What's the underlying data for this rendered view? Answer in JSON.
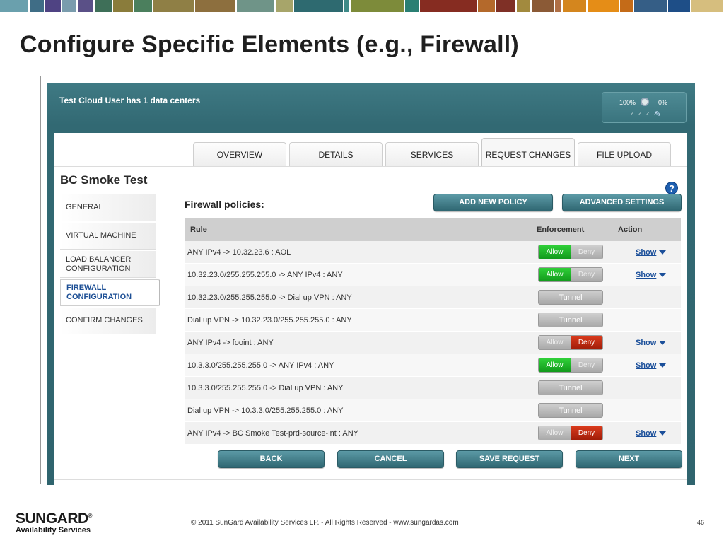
{
  "colors": {
    "topbar": [
      "#6aa0ad",
      "#3f6d86",
      "#4f4383",
      "#7a9cad",
      "#5a5087",
      "#3e6f58",
      "#8a7c3b",
      "#4b7f5d",
      "#8f7f45",
      "#8d6f3e",
      "#6f9488",
      "#a7a56a",
      "#2e6a70",
      "#3e8a88",
      "#7d8b3a",
      "#2a7f73",
      "#862c21",
      "#b4692b",
      "#7f3026",
      "#a28a3e",
      "#8b5a36",
      "#b06f45",
      "#d4861e",
      "#e58d17",
      "#c46b18",
      "#355e86",
      "#1e4e87",
      "#d6be7e"
    ],
    "accent": "#2f646e",
    "allow_green": "#129a1c",
    "deny_red": "#a01d08"
  },
  "slide_title": "Configure Specific Elements (e.g., Firewall)",
  "app": {
    "header_text": "Test Cloud User has 1 data centers",
    "gauge": {
      "left": "100%",
      "right": "0%"
    }
  },
  "tabs": [
    "OVERVIEW",
    "DETAILS",
    "SERVICES",
    "REQUEST CHANGES",
    "FILE UPLOAD"
  ],
  "active_tab": "REQUEST CHANGES",
  "panel_title": "BC Smoke Test",
  "sidenav": [
    {
      "label": "GENERAL",
      "active": false
    },
    {
      "label": "VIRTUAL MACHINE",
      "active": false
    },
    {
      "label": "LOAD BALANCER CONFIGURATION",
      "active": false
    },
    {
      "label": "FIREWALL CONFIGURATION",
      "active": true
    },
    {
      "label": "CONFIRM CHANGES",
      "active": false
    }
  ],
  "firewall": {
    "heading": "Firewall policies:",
    "add_button": "ADD NEW POLICY",
    "advanced_button": "ADVANCED SETTINGS",
    "columns": [
      "Rule",
      "Enforcement",
      "Action"
    ],
    "rows": [
      {
        "rule": "ANY IPv4 -> 10.32.23.6 : AOL",
        "mode": "allow",
        "action": "Show"
      },
      {
        "rule": "10.32.23.0/255.255.255.0 -> ANY IPv4 : ANY",
        "mode": "allow",
        "action": "Show"
      },
      {
        "rule": "10.32.23.0/255.255.255.0 -> Dial up VPN : ANY",
        "mode": "tunnel",
        "action": ""
      },
      {
        "rule": "Dial up VPN -> 10.32.23.0/255.255.255.0 : ANY",
        "mode": "tunnel",
        "action": ""
      },
      {
        "rule": "ANY IPv4 -> fooint : ANY",
        "mode": "deny",
        "action": "Show"
      },
      {
        "rule": "10.3.3.0/255.255.255.0 -> ANY IPv4 : ANY",
        "mode": "allow",
        "action": "Show"
      },
      {
        "rule": "10.3.3.0/255.255.255.0 -> Dial up VPN : ANY",
        "mode": "tunnel",
        "action": ""
      },
      {
        "rule": "Dial up VPN -> 10.3.3.0/255.255.255.0 : ANY",
        "mode": "tunnel",
        "action": ""
      },
      {
        "rule": "ANY IPv4 -> BC Smoke Test-prd-source-int : ANY",
        "mode": "deny",
        "action": "Show"
      }
    ],
    "toggle_labels": {
      "allow": "Allow",
      "deny": "Deny",
      "tunnel": "Tunnel"
    }
  },
  "footer_buttons": [
    "BACK",
    "CANCEL",
    "SAVE REQUEST",
    "NEXT"
  ],
  "footer": {
    "logo_brand": "SUNGARD",
    "logo_mark": "®",
    "logo_sub": "Availability Services",
    "copyright": "© 2011 SunGard Availability Services LP. - All Rights Reserved - www.sungardas.com",
    "page_number": "46"
  }
}
